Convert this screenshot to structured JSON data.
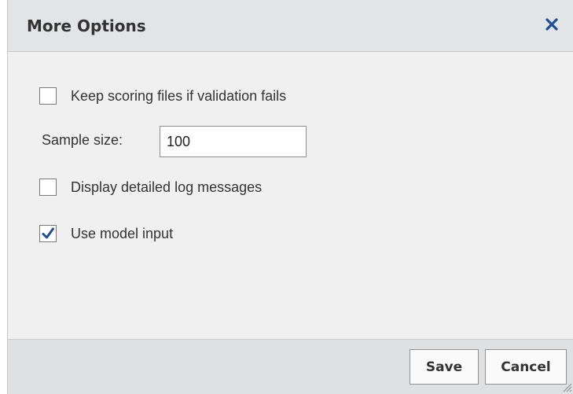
{
  "dialog": {
    "title": "More Options",
    "close_icon": "close-icon"
  },
  "options": {
    "keep_scoring": {
      "label": "Keep scoring files if validation fails",
      "checked": false
    },
    "sample_size": {
      "label": "Sample size:",
      "value": "100"
    },
    "detailed_log": {
      "label": "Display detailed log messages",
      "checked": false
    },
    "model_input": {
      "label": "Use model input",
      "checked": true
    }
  },
  "footer": {
    "save_label": "Save",
    "cancel_label": "Cancel"
  },
  "colors": {
    "check_mark": "#1f4e96",
    "close_icon": "#1f4e96"
  }
}
